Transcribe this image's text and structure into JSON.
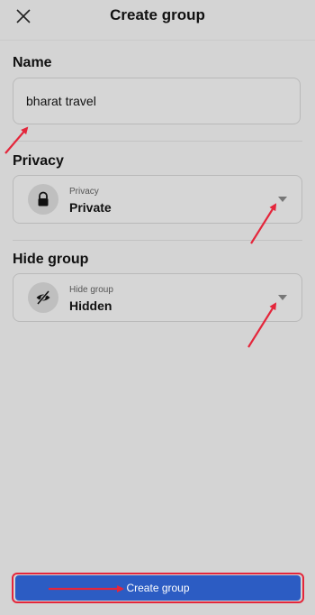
{
  "header": {
    "title": "Create group",
    "close_icon": "close-icon"
  },
  "name_section": {
    "label": "Name",
    "value": "bharat travel"
  },
  "privacy_section": {
    "label": "Privacy",
    "field_label": "Privacy",
    "value": "Private",
    "icon": "lock-icon"
  },
  "hide_section": {
    "label": "Hide group",
    "field_label": "Hide group",
    "value": "Hidden",
    "icon": "eye-slash-icon"
  },
  "footer": {
    "create_label": "Create group"
  },
  "colors": {
    "background": "#d4d4d4",
    "button": "#2c5cc3",
    "annotation": "#e4263b"
  }
}
